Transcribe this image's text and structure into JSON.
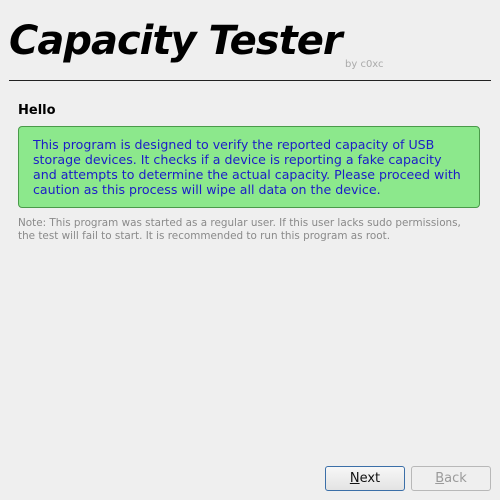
{
  "header": {
    "title": "Capacity Tester",
    "byline": "by c0xc"
  },
  "page": {
    "heading": "Hello",
    "info": "This program is designed to verify the reported capacity of USB storage devices. It checks if a device is reporting a fake capacity and attempts to determine the actual capacity. Please proceed with caution as this process will wipe all data on the device.",
    "note": "Note: This program was started as a regular user. If this user lacks sudo permissions, the test will fail to start. It is recommended to run this program as root."
  },
  "buttons": {
    "next": {
      "mnemonic": "N",
      "rest": "ext",
      "enabled": true
    },
    "back": {
      "mnemonic": "B",
      "rest": "ack",
      "enabled": false
    }
  },
  "colors": {
    "info_background": "#8ce88c",
    "info_text": "#1c1cc8",
    "note_text": "#8a8a8a"
  }
}
